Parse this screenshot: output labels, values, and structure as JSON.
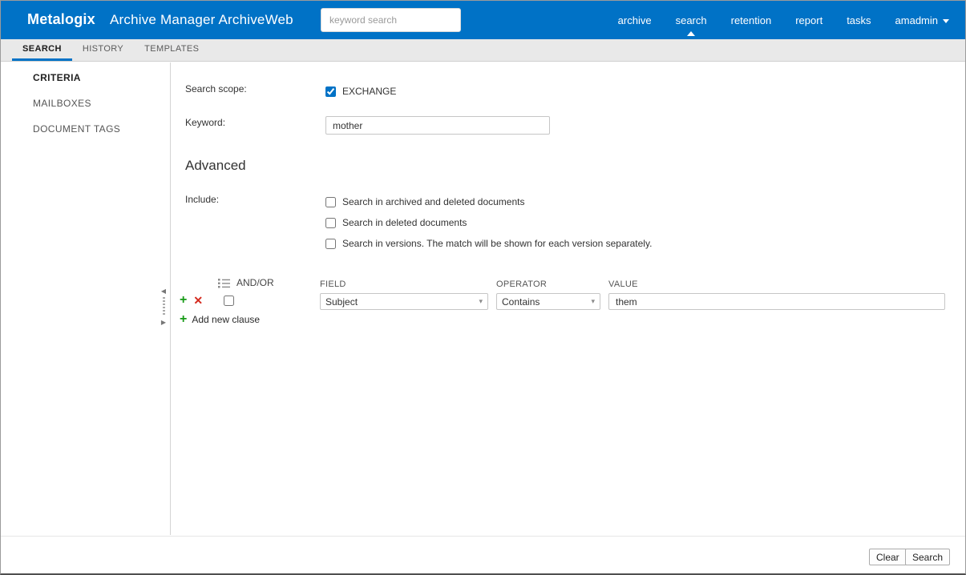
{
  "header": {
    "logo": "Metalogix",
    "app_title": "Archive Manager ArchiveWeb",
    "search_placeholder": "keyword search",
    "nav": [
      {
        "label": "archive"
      },
      {
        "label": "search"
      },
      {
        "label": "retention"
      },
      {
        "label": "report"
      },
      {
        "label": "tasks"
      },
      {
        "label": "amadmin"
      }
    ]
  },
  "tabs": [
    {
      "label": "SEARCH"
    },
    {
      "label": "HISTORY"
    },
    {
      "label": "TEMPLATES"
    }
  ],
  "sidebar": {
    "items": [
      {
        "label": "CRITERIA"
      },
      {
        "label": "MAILBOXES"
      },
      {
        "label": "DOCUMENT TAGS"
      }
    ]
  },
  "form": {
    "search_scope_label": "Search scope:",
    "exchange_label": "EXCHANGE",
    "keyword_label": "Keyword:",
    "keyword_value": "mother",
    "advanced_heading": "Advanced",
    "include_label": "Include:",
    "include_options": [
      "Search in archived and deleted documents",
      "Search in deleted documents",
      "Search in versions. The match will be shown for each version separately."
    ]
  },
  "clause": {
    "andor_label": "AND/OR",
    "field_label": "FIELD",
    "field_value": "Subject",
    "operator_label": "OPERATOR",
    "operator_value": "Contains",
    "value_label": "VALUE",
    "value_text": "them",
    "add_new_clause_label": "Add new clause"
  },
  "footer": {
    "clear_label": "Clear",
    "search_label": "Search"
  },
  "colors": {
    "header_bg": "#0072c6",
    "accent": "#0072c6",
    "plus_green": "#169a16",
    "remove_red": "#d42a1e"
  }
}
